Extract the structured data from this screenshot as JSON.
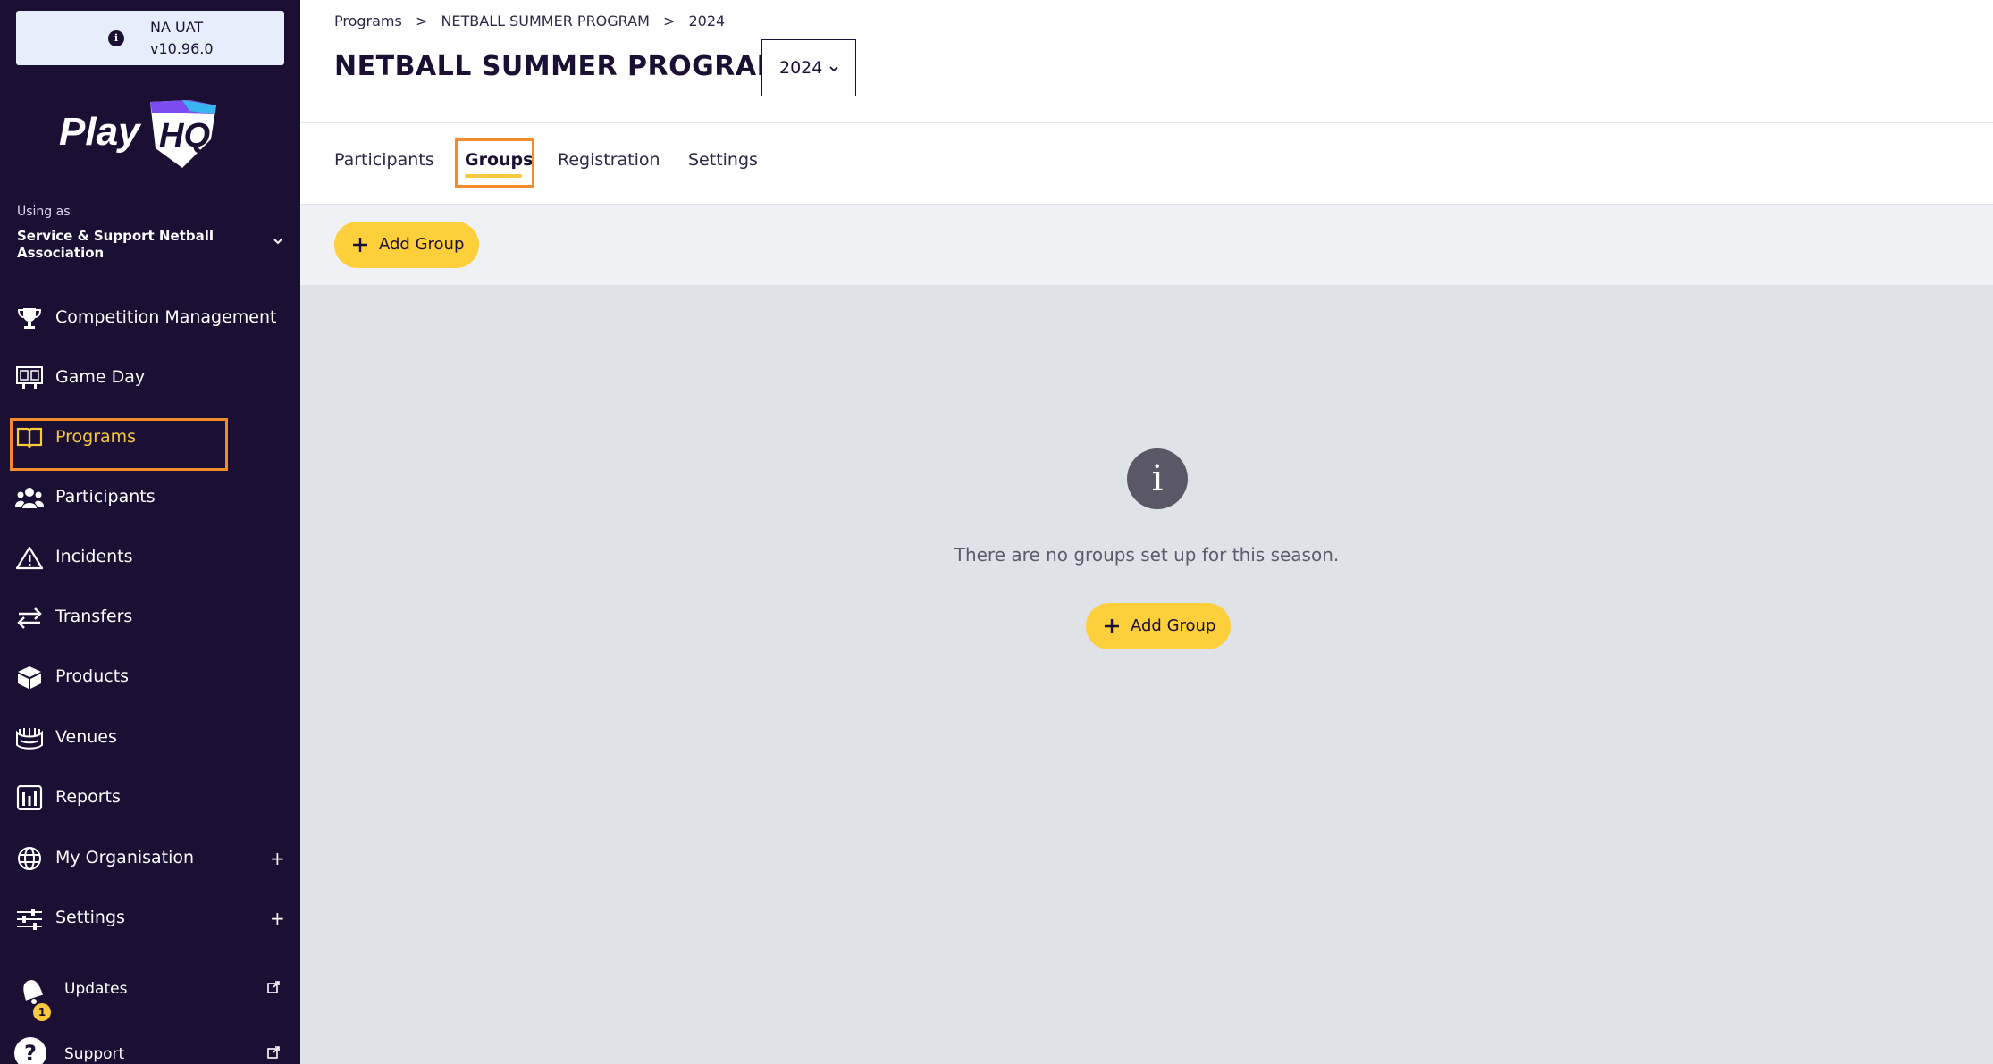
{
  "env": {
    "name": "NA UAT",
    "version": "v10.96.0"
  },
  "brand": {
    "logo_text": "PlayHQ",
    "accent": "#f8c93c",
    "sidebar_bg": "#1b0f34",
    "highlight": "#f58a2c"
  },
  "using_as": {
    "label": "Using as",
    "org": "Service & Support Netball Association"
  },
  "nav": [
    {
      "label": "Competition Management",
      "icon": "trophy-icon"
    },
    {
      "label": "Game Day",
      "icon": "scoreboard-icon"
    },
    {
      "label": "Programs",
      "icon": "book-icon",
      "active": true
    },
    {
      "label": "Participants",
      "icon": "people-icon"
    },
    {
      "label": "Incidents",
      "icon": "warning-icon"
    },
    {
      "label": "Transfers",
      "icon": "transfer-icon"
    },
    {
      "label": "Products",
      "icon": "box-icon"
    },
    {
      "label": "Venues",
      "icon": "stadium-icon"
    },
    {
      "label": "Reports",
      "icon": "chart-icon"
    },
    {
      "label": "My Organisation",
      "icon": "globe-icon",
      "expand": "+"
    },
    {
      "label": "Settings",
      "icon": "sliders-icon",
      "expand": "+"
    }
  ],
  "bottom": {
    "updates": {
      "label": "Updates",
      "count": "1"
    },
    "support": {
      "label": "Support"
    }
  },
  "breadcrumb": [
    "Programs",
    "NETBALL SUMMER PROGRAM",
    "2024"
  ],
  "breadcrumb_sep": ">",
  "page_title": "NETBALL SUMMER PROGRAM",
  "season": {
    "selected": "2024"
  },
  "tabs": [
    {
      "label": "Participants"
    },
    {
      "label": "Groups",
      "active": true
    },
    {
      "label": "Registration"
    },
    {
      "label": "Settings"
    }
  ],
  "toolbar": {
    "add_group": "Add Group"
  },
  "empty_state": {
    "icon_glyph": "i",
    "message": "There are no groups set up for this season.",
    "add_group": "Add Group"
  }
}
